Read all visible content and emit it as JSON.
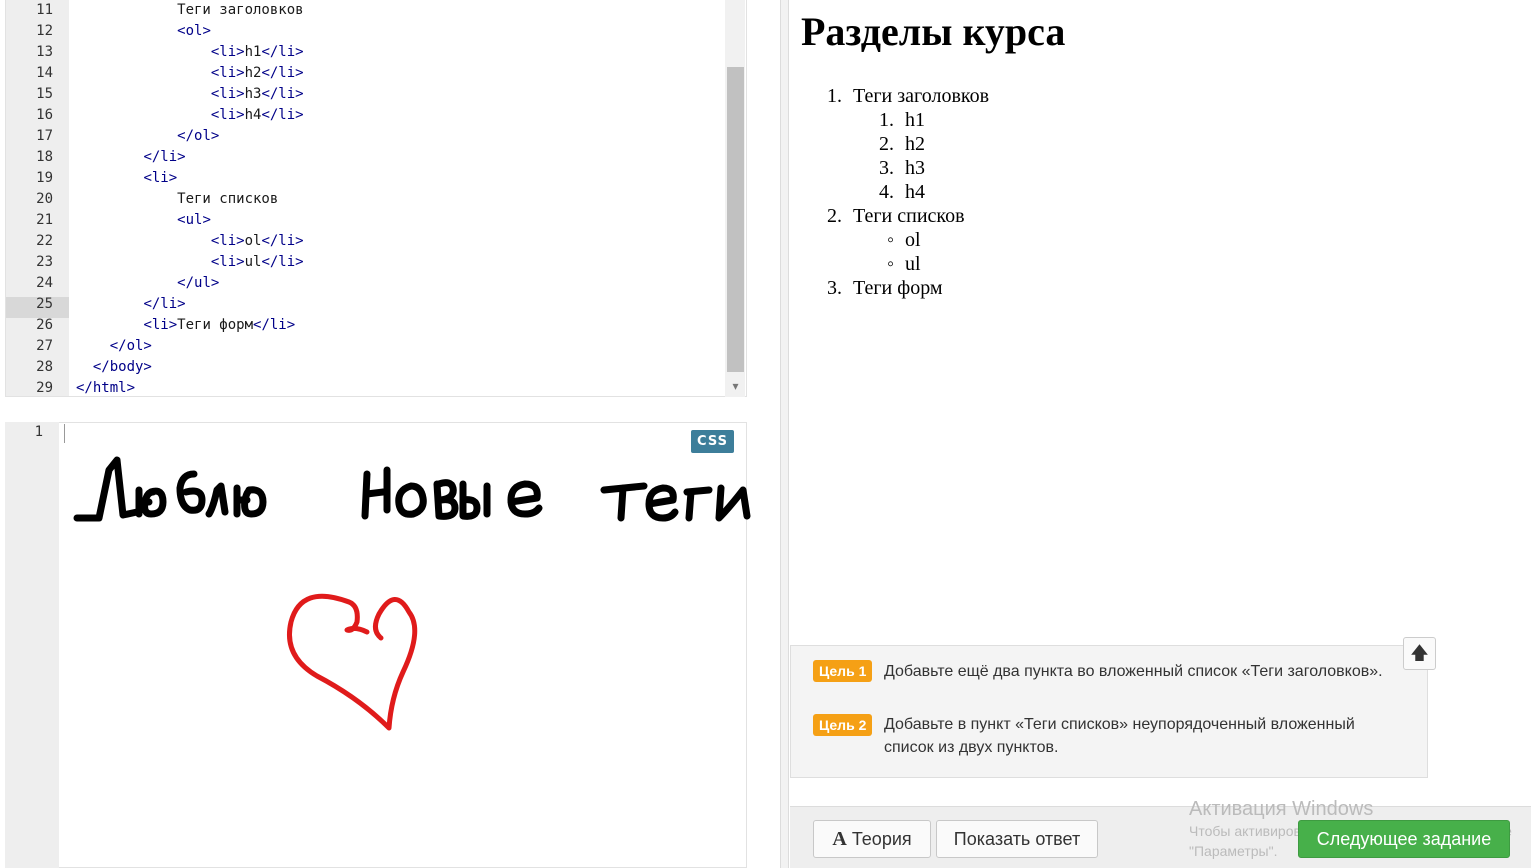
{
  "html_editor": {
    "line_numbers": [
      "11",
      "12",
      "13",
      "14",
      "15",
      "16",
      "17",
      "18",
      "19",
      "20",
      "21",
      "22",
      "23",
      "24",
      "25",
      "26",
      "27",
      "28",
      "29"
    ],
    "lines": [
      "            Теги заголовков",
      "            <ol>",
      "                <li>h1</li>",
      "                <li>h2</li>",
      "                <li>h3</li>",
      "                <li>h4</li>",
      "            </ol>",
      "        </li>",
      "        <li>",
      "            Теги списков",
      "            <ul>",
      "                <li>ol</li>",
      "                <li>ul</li>",
      "            </ul>",
      "        </li>",
      "        <li>Теги форм</li>",
      "    </ol>",
      "  </body>",
      "</html>"
    ]
  },
  "css_editor": {
    "line_number": "1",
    "badge": "CSS",
    "handwriting": "Люблю новые теги"
  },
  "preview": {
    "title": "Разделы курса",
    "items": [
      {
        "marker": "1.",
        "text": "Теги заголовков"
      },
      {
        "marker": "1.",
        "text": "h1"
      },
      {
        "marker": "2.",
        "text": "h2"
      },
      {
        "marker": "3.",
        "text": "h3"
      },
      {
        "marker": "4.",
        "text": "h4"
      },
      {
        "marker": "2.",
        "text": "Теги списков"
      },
      {
        "marker": "◦",
        "text": "ol"
      },
      {
        "marker": "◦",
        "text": "ul"
      },
      {
        "marker": "3.",
        "text": "Теги форм"
      }
    ]
  },
  "goals": [
    {
      "badge": "Цель 1",
      "text": "Добавьте ещё два пункта во вложенный список «Теги заголовков»."
    },
    {
      "badge": "Цель 2",
      "text": "Добавьте в пункт «Теги списков» неупорядоченный вложенный список из двух пунктов."
    }
  ],
  "buttons": {
    "theory_icon": "A",
    "theory": "Теория",
    "show_answer": "Показать ответ",
    "next": "Следующее задание"
  },
  "watermark": {
    "title": "Активация Windows",
    "line1": "Чтобы активировать Windows, перейдите в разде",
    "line2": "\"Параметры\"."
  },
  "colors": {
    "goal_badge": "#f5a015",
    "next_button": "#47b04a",
    "css_badge": "#3d7e9a",
    "heart": "#e01b1b"
  }
}
